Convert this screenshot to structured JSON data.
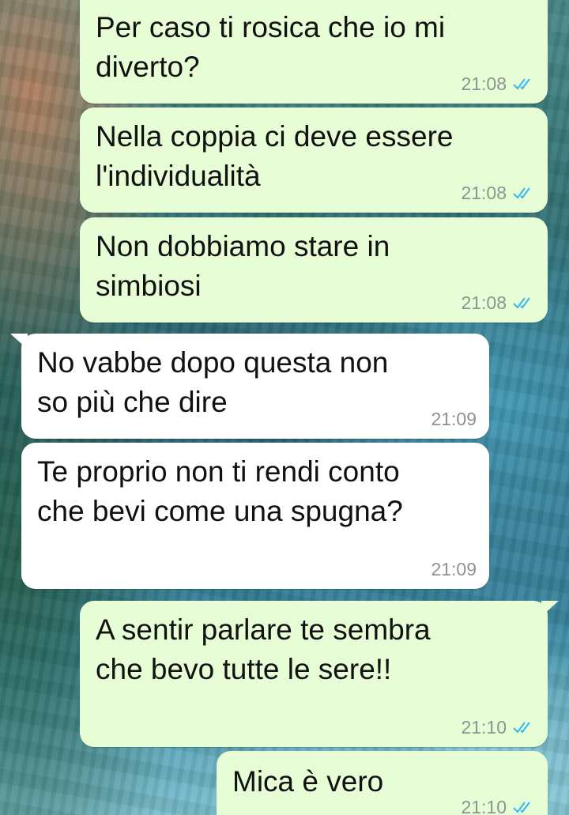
{
  "messages": [
    {
      "direction": "out",
      "text": "Per caso ti rosica che io mi\ndiverto?",
      "time": "21:08",
      "ticks": "double-check-icon"
    },
    {
      "direction": "out",
      "text": "Nella coppia ci deve essere\nl'individualità",
      "time": "21:08",
      "ticks": "double-check-icon"
    },
    {
      "direction": "out",
      "text": "Non dobbiamo stare in\nsimbiosi",
      "time": "21:08",
      "ticks": "double-check-icon"
    },
    {
      "direction": "in",
      "text": "No vabbe dopo questa non\nso più che dire",
      "time": "21:09"
    },
    {
      "direction": "in",
      "text": "Te proprio non ti rendi conto\nche bevi come una spugna?",
      "time": "21:09"
    },
    {
      "direction": "out",
      "text": "A sentir parlare te sembra\nche bevo tutte le sere!!",
      "time": "21:10",
      "ticks": "double-check-icon"
    },
    {
      "direction": "out",
      "text": "Mica è vero",
      "time": "21:10",
      "ticks": "double-check-icon"
    }
  ],
  "colors": {
    "outgoing_bubble": "#e7fdd6",
    "incoming_bubble": "#ffffff",
    "read_ticks": "#34b7f1",
    "timestamp": "#8a9590"
  }
}
